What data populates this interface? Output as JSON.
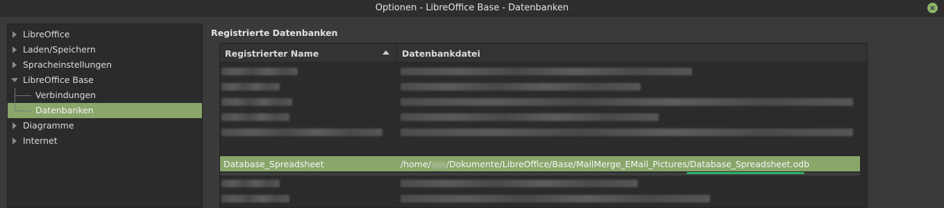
{
  "window": {
    "title": "Optionen - LibreOffice Base - Datenbanken",
    "close_glyph": "⨯"
  },
  "tree": {
    "items": [
      {
        "label": "LibreOffice",
        "expanded": false
      },
      {
        "label": "Laden/Speichern",
        "expanded": false
      },
      {
        "label": "Spracheinstellungen",
        "expanded": false
      },
      {
        "label": "LibreOffice Base",
        "expanded": true
      },
      {
        "label": "Verbindungen",
        "child": true
      },
      {
        "label": "Datenbanken",
        "child": true,
        "selected": true
      },
      {
        "label": "Diagramme",
        "expanded": false
      },
      {
        "label": "Internet",
        "expanded": false
      }
    ]
  },
  "section": {
    "title": "Registrierte Datenbanken"
  },
  "table": {
    "columns": [
      "Registrierter Name",
      "Datenbankdatei"
    ],
    "sort_column": "Registrierter Name",
    "sort_direction": "ascending",
    "selected_row": {
      "name": "Database_Spreadsheet",
      "path_prefix": "/home/",
      "path_suffix": "/Dokumente/LibreOffice/Base/MailMerge_EMail_Pictures/Database_Spreadsheet.odb"
    }
  },
  "colors": {
    "selection": "#8aa66b",
    "underline": "#2fb36b",
    "background": "#3a3a3a"
  }
}
